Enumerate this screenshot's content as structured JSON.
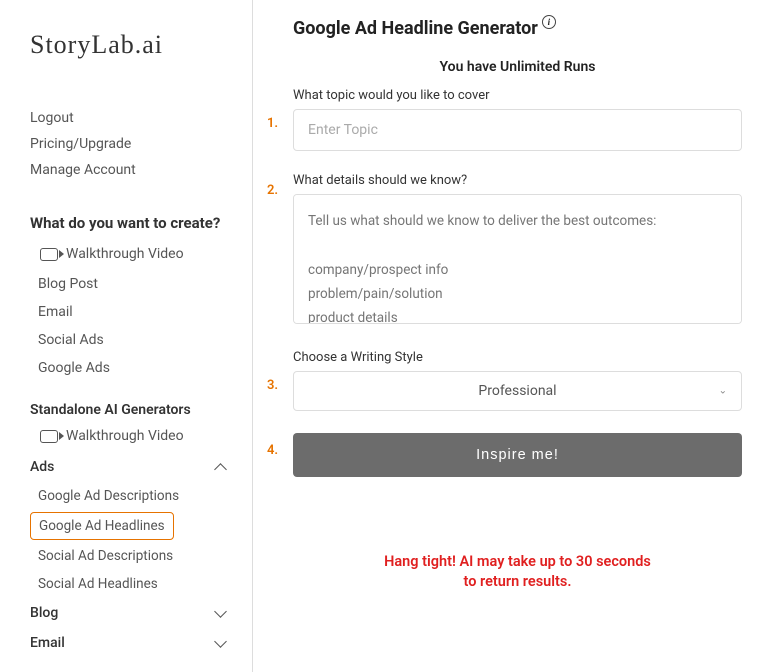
{
  "logo": "StoryLab.ai",
  "nav": {
    "logout": "Logout",
    "pricing": "Pricing/Upgrade",
    "manage": "Manage Account"
  },
  "create": {
    "heading": "What do you want to create?",
    "walkthrough": "Walkthrough Video",
    "items": {
      "blog": "Blog Post",
      "email": "Email",
      "social": "Social Ads",
      "google": "Google Ads"
    }
  },
  "standalone": {
    "heading": "Standalone AI Generators",
    "walkthrough": "Walkthrough Video"
  },
  "accordion": {
    "ads": "Ads",
    "blog": "Blog",
    "email": "Email",
    "ads_items": {
      "gad_desc": "Google Ad Descriptions",
      "gad_head": "Google Ad Headlines",
      "sad_desc": "Social Ad Descriptions",
      "sad_head": "Social Ad Headlines"
    }
  },
  "page": {
    "title": "Google Ad Headline Generator",
    "runs": "You have Unlimited Runs",
    "topic_label": "What topic would you like to cover",
    "topic_placeholder": "Enter Topic",
    "details_label": "What details should we know?",
    "details_placeholder": "Tell us what should we know to deliver the best outcomes:\n\ncompany/prospect info\nproblem/pain/solution\nproduct details\nyour secret sauce (Just kidding)",
    "style_label": "Choose a Writing Style",
    "style_value": "Professional",
    "button": "Inspire me!",
    "wait": "Hang tight! AI may take up to 30 seconds\nto return results.",
    "steps": {
      "s1": "1.",
      "s2": "2.",
      "s3": "3.",
      "s4": "4."
    }
  }
}
